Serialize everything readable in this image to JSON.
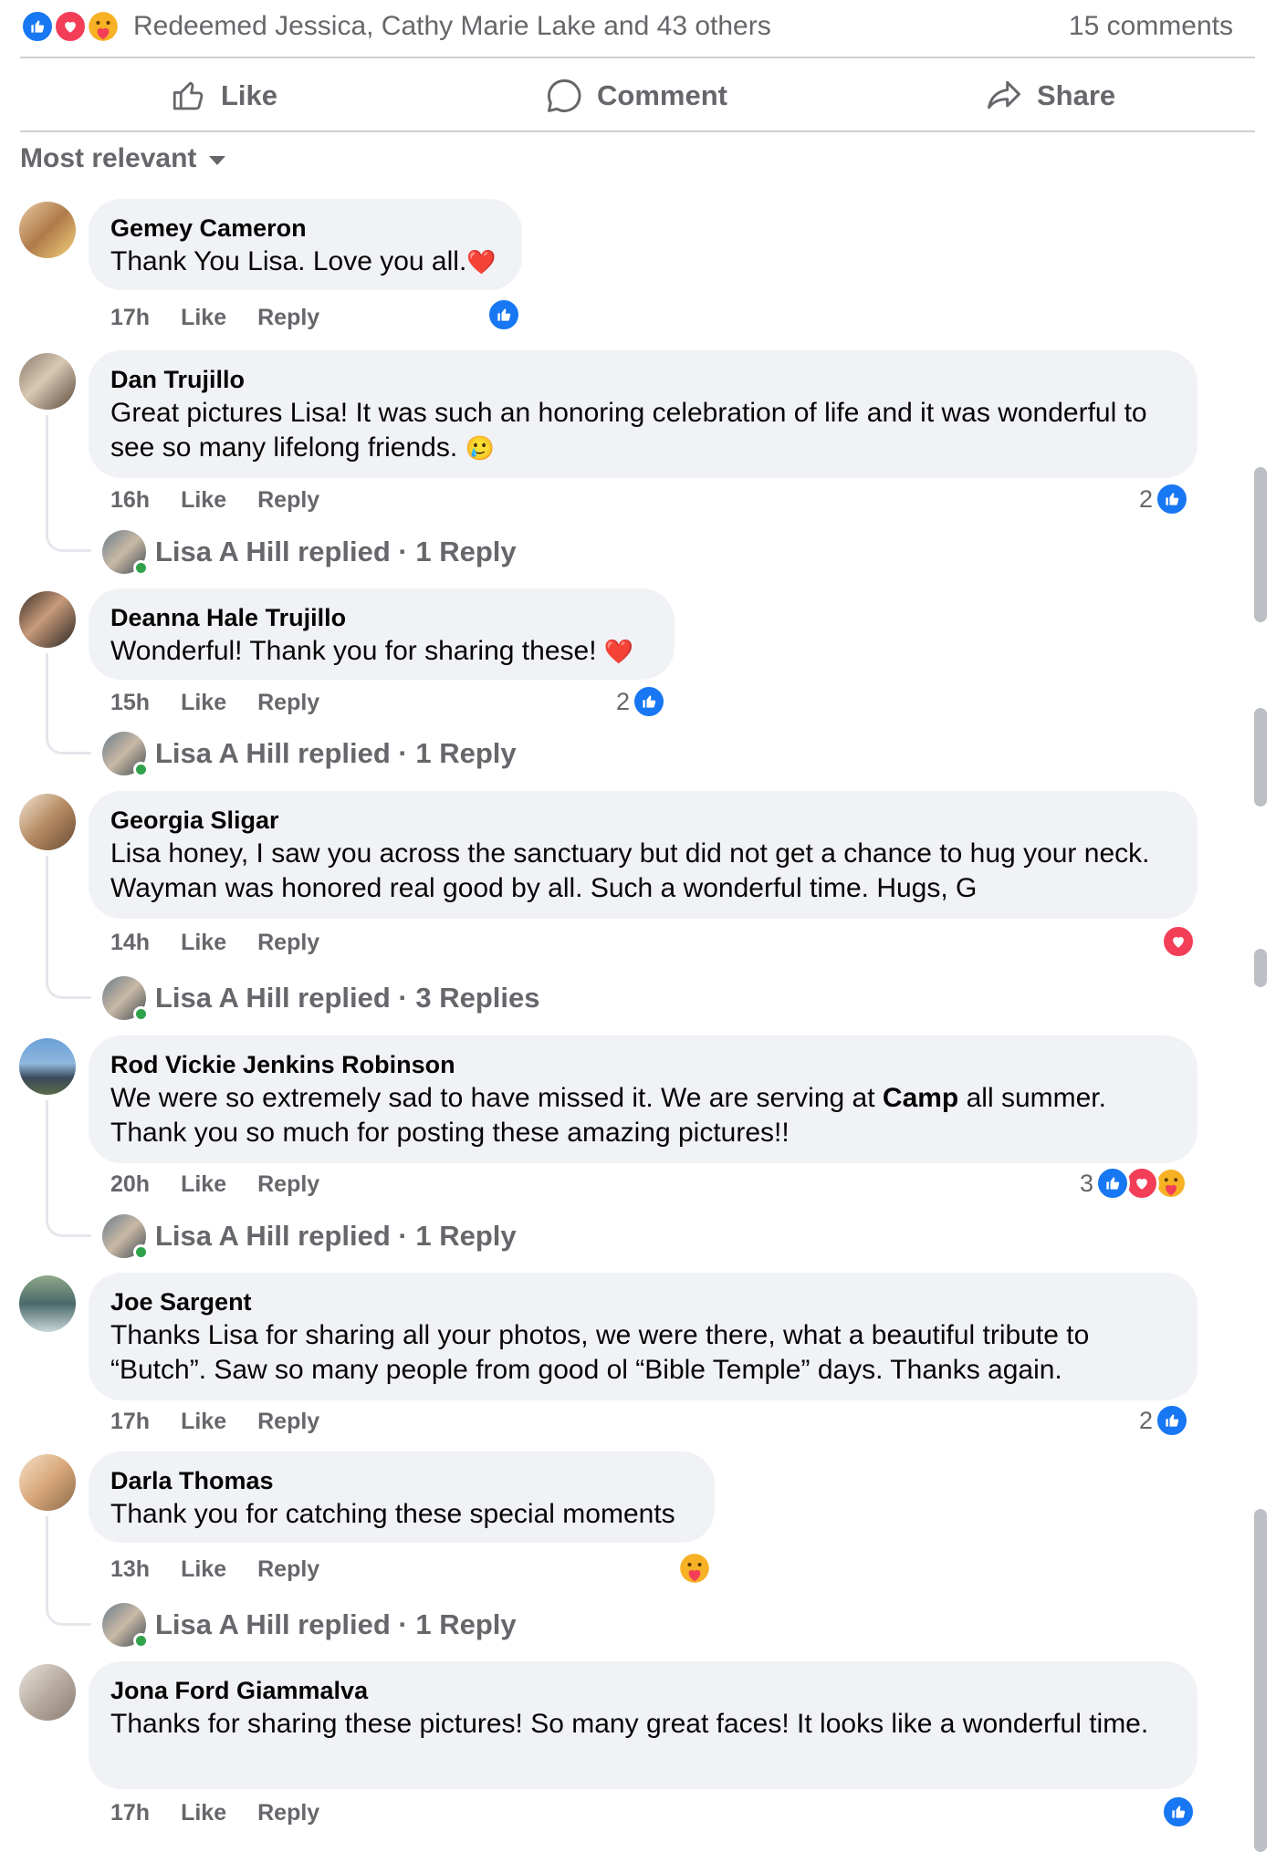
{
  "post_footer": {
    "reaction_icons": [
      "like-icon",
      "love-icon",
      "care-icon"
    ],
    "reaction_summary": "Redeemed Jessica, Cathy Marie Lake and 43 others",
    "comment_count": "15 comments"
  },
  "actions": {
    "like": "Like",
    "comment": "Comment",
    "share": "Share"
  },
  "sort": {
    "label": "Most relevant"
  },
  "colors": {
    "like_blue": "#1877f2",
    "love_red": "#f33e58",
    "care_yellow": "#f7b125",
    "muted": "#65676b",
    "bubble_bg": "#f0f2f5",
    "online_green": "#31a24c"
  },
  "comments": [
    {
      "author": "Gemey Cameron",
      "text": "Thank You Lisa. Love you all.",
      "emoji": "❤️",
      "time": "17h",
      "like": "Like",
      "reply": "Reply",
      "reaction_count": "",
      "reactions": [
        "like"
      ],
      "replied": ""
    },
    {
      "author": "Dan Trujillo",
      "text": "Great pictures Lisa! It was such an honoring celebration of life and it was wonderful to see so many lifelong friends.",
      "emoji": "🥲",
      "time": "16h",
      "like": "Like",
      "reply": "Reply",
      "reaction_count": "2",
      "reactions": [
        "like"
      ],
      "replied": "Lisa A Hill replied · 1 Reply"
    },
    {
      "author": "Deanna Hale Trujillo",
      "text": "Wonderful! Thank you for sharing these!",
      "emoji": "❤️",
      "time": "15h",
      "like": "Like",
      "reply": "Reply",
      "reaction_count": "2",
      "reactions": [
        "like"
      ],
      "replied": "Lisa A Hill replied · 1 Reply"
    },
    {
      "author": "Georgia Sligar",
      "text": "Lisa honey, I saw you across the sanctuary but did not get a chance to hug your neck. Wayman was honored real good by all. Such a wonderful time. Hugs, G",
      "emoji": "",
      "time": "14h",
      "like": "Like",
      "reply": "Reply",
      "reaction_count": "",
      "reactions": [
        "love"
      ],
      "replied": "Lisa A Hill replied · 3 Replies"
    },
    {
      "author": "Rod Vickie Jenkins Robinson",
      "text_before": "We were so extremely sad to have missed it. We are serving at ",
      "text_bold": "Camp",
      "text_after": " all summer. Thank you so much for posting these amazing pictures!!",
      "time": "20h",
      "like": "Like",
      "reply": "Reply",
      "reaction_count": "3",
      "reactions": [
        "like",
        "love",
        "care"
      ],
      "replied": "Lisa A Hill replied · 1 Reply"
    },
    {
      "author": "Joe Sargent",
      "text": "Thanks Lisa for sharing all your photos, we were there, what a beautiful tribute to “Butch”. Saw so many people from good ol “Bible Temple” days. Thanks again.",
      "emoji": "",
      "time": "17h",
      "like": "Like",
      "reply": "Reply",
      "reaction_count": "2",
      "reactions": [
        "like"
      ],
      "replied": ""
    },
    {
      "author": "Darla Thomas",
      "text": "Thank you for catching these special moments",
      "emoji": "",
      "time": "13h",
      "like": "Like",
      "reply": "Reply",
      "reaction_count": "",
      "reactions": [
        "care"
      ],
      "replied": "Lisa A Hill replied · 1 Reply"
    },
    {
      "author": "Jona Ford Giammalva",
      "text": "Thanks for sharing these pictures! So many great faces! It looks like a wonderful time.",
      "emoji": "",
      "time": "17h",
      "like": "Like",
      "reply": "Reply",
      "reaction_count": "",
      "reactions": [
        "like"
      ],
      "replied": ""
    }
  ]
}
